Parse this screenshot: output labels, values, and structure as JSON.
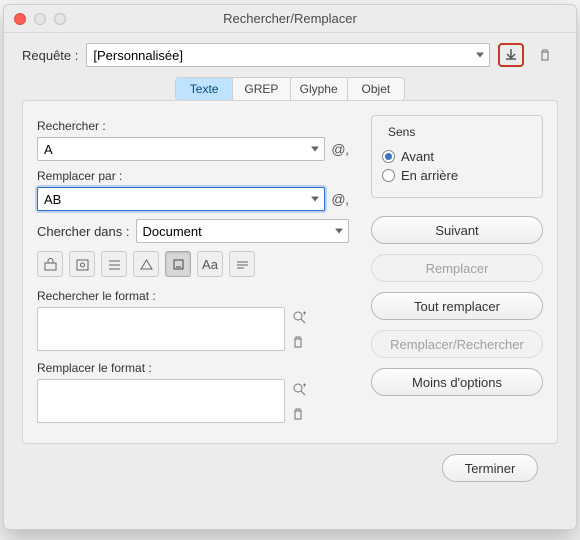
{
  "window": {
    "title": "Rechercher/Remplacer"
  },
  "query": {
    "label": "Requête :",
    "selected": "[Personnalisée]"
  },
  "tabs": {
    "text": "Texte",
    "grep": "GREP",
    "glyph": "Glyphe",
    "object": "Objet",
    "active": "text"
  },
  "find": {
    "label": "Rechercher :",
    "value": "A"
  },
  "replace": {
    "label": "Remplacer par :",
    "value": "AB"
  },
  "search_in": {
    "label": "Chercher dans :",
    "selected": "Document"
  },
  "format_find": {
    "label": "Rechercher le format :"
  },
  "format_replace": {
    "label": "Remplacer le format :"
  },
  "direction": {
    "legend": "Sens",
    "forward": "Avant",
    "backward": "En arrière",
    "selected": "forward"
  },
  "buttons": {
    "next": "Suivant",
    "replace": "Remplacer",
    "replace_all": "Tout remplacer",
    "replace_find": "Remplacer/Rechercher",
    "fewer": "Moins d'options",
    "done": "Terminer"
  },
  "toolbar_glyphs": {
    "aa": "Aa"
  }
}
